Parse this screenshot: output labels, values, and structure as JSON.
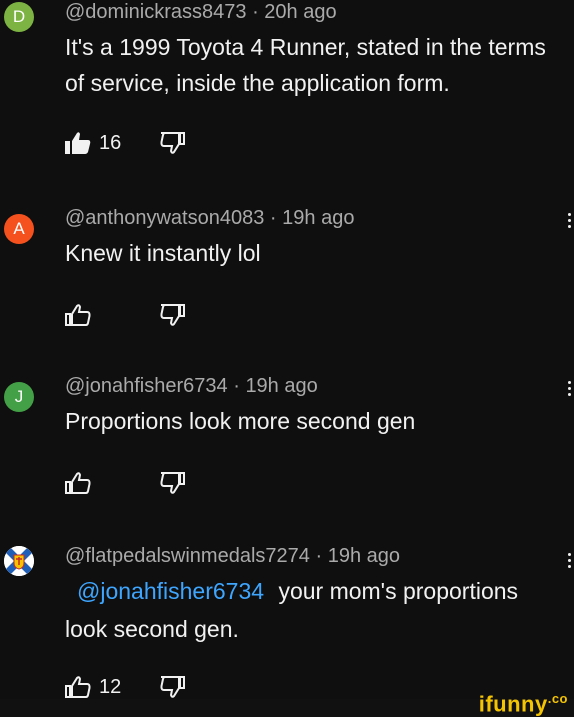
{
  "comments": [
    {
      "avatar_letter": "D",
      "avatar_color": "#7cb342",
      "author": "@dominickrass8473",
      "time": "20h ago",
      "text": "It's a 1999 Toyota 4 Runner, stated in the terms of service, inside the application form.",
      "likes": "16",
      "liked": true
    },
    {
      "avatar_letter": "A",
      "avatar_color": "#f4511e",
      "author": "@anthonywatson4083",
      "time": "19h ago",
      "text": "Knew it instantly lol",
      "likes": "",
      "liked": false
    },
    {
      "avatar_letter": "J",
      "avatar_color": "#43a047",
      "author": "@jonahfisher6734",
      "time": "19h ago",
      "text": "Proportions look more second gen",
      "likes": "",
      "liked": false
    },
    {
      "avatar_icon": "nova-scotia-flag-icon",
      "author": "@flatpedalswinmedals7274",
      "time": "19h ago",
      "mention": "@jonahfisher6734",
      "text_after_mention": "your mom's proportions",
      "text_line2": "look second gen.",
      "likes": "12",
      "liked": false
    }
  ],
  "separator": "·",
  "watermark": {
    "text": "ifunny",
    "suffix": ".co"
  },
  "colors": {
    "background": "#0f0f0f",
    "text": "#f1f1f1",
    "meta": "#aaaaaa",
    "mention": "#3ea6ff",
    "watermark": "#f5c400"
  }
}
